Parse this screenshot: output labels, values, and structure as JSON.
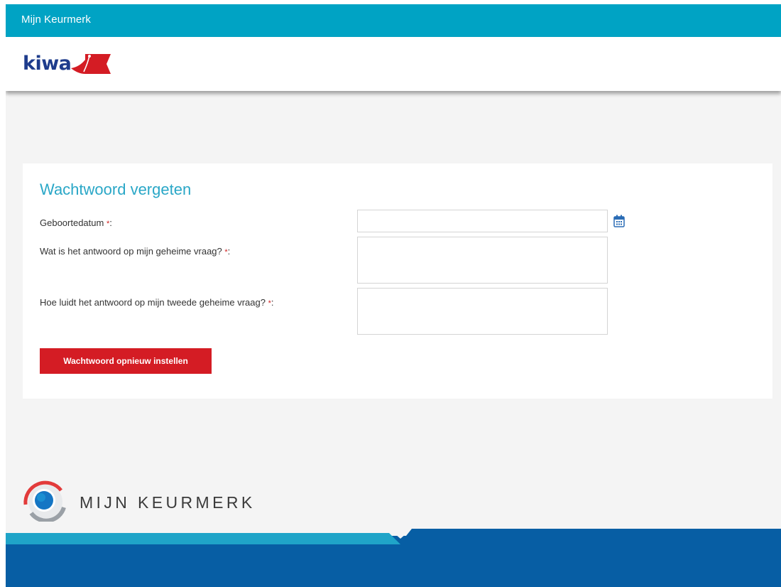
{
  "topbar": {
    "title": "Mijn Keurmerk"
  },
  "header": {
    "logo_text": "kiwa"
  },
  "form": {
    "title": "Wachtwoord vergeten",
    "required_marker": "*",
    "fields": [
      {
        "label": "Geboortedatum",
        "value": "",
        "suffix": ":"
      },
      {
        "label": "Wat is het antwoord op mijn geheime vraag?",
        "value": "",
        "suffix": ":"
      },
      {
        "label": "Hoe luidt het antwoord op mijn tweede geheime vraag?",
        "value": "",
        "suffix": ":"
      }
    ],
    "submit_label": "Wachtwoord opnieuw instellen"
  },
  "footer": {
    "logo_text": "MIJN KEURMERK"
  },
  "colors": {
    "topbar": "#00a3c4",
    "title": "#2aa7c7",
    "button": "#d41c24",
    "kiwa_blue": "#1e3c8c",
    "bottom_light": "#1fa4c8",
    "bottom_dark": "#075ea4"
  },
  "icons": {
    "calendar": "calendar-icon",
    "footer_logo": "keurmerk-logo-icon",
    "kiwa_flag": "kiwa-flag-icon"
  }
}
